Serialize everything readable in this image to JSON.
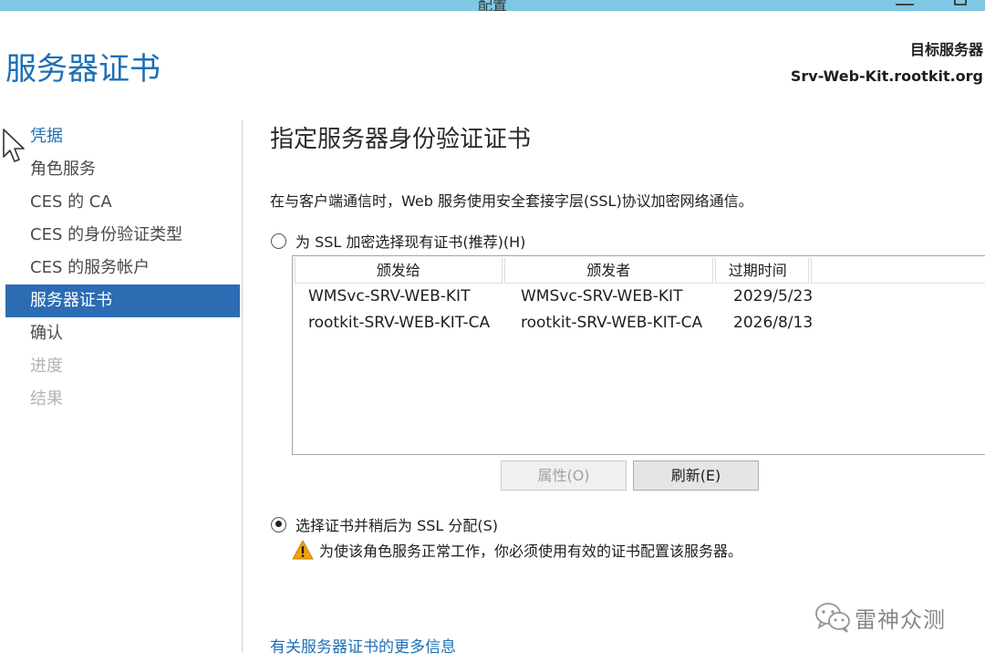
{
  "window": {
    "title": "配置"
  },
  "header": {
    "page_title": "服务器证书",
    "target_label": "目标服务器",
    "target_server": "Srv-Web-Kit.rootkit.org"
  },
  "nav": {
    "items": [
      {
        "label": "凭据",
        "state": "link"
      },
      {
        "label": "角色服务",
        "state": "normal"
      },
      {
        "label": "CES 的 CA",
        "state": "normal"
      },
      {
        "label": "CES 的身份验证类型",
        "state": "normal"
      },
      {
        "label": "CES 的服务帐户",
        "state": "normal"
      },
      {
        "label": "服务器证书",
        "state": "selected"
      },
      {
        "label": "确认",
        "state": "normal"
      },
      {
        "label": "进度",
        "state": "disabled"
      },
      {
        "label": "结果",
        "state": "disabled"
      }
    ]
  },
  "main": {
    "section_title": "指定服务器身份验证证书",
    "description": "在与客户端通信时，Web 服务使用安全套接字层(SSL)协议加密网络通信。",
    "option_existing": {
      "label": "为 SSL 加密选择现有证书(推荐)(H)",
      "checked": false
    },
    "cert_table": {
      "columns": [
        "颁发给",
        "颁发者",
        "过期时间"
      ],
      "rows": [
        {
          "issued_to": "WMSvc-SRV-WEB-KIT",
          "issued_by": "WMSvc-SRV-WEB-KIT",
          "expires": "2029/5/23"
        },
        {
          "issued_to": "rootkit-SRV-WEB-KIT-CA",
          "issued_by": "rootkit-SRV-WEB-KIT-CA",
          "expires": "2026/8/13"
        }
      ]
    },
    "buttons": {
      "properties": "属性(O)",
      "refresh": "刷新(E)"
    },
    "option_later": {
      "label": "选择证书并稍后为 SSL 分配(S)",
      "checked": true
    },
    "warning": "为使该角色服务正常工作，你必须使用有效的证书配置该服务器。",
    "more_info_link": "有关服务器证书的更多信息"
  },
  "watermark": {
    "text": "雷神众测"
  },
  "colors": {
    "accent": "#1d6fb5",
    "selected_bg": "#2b6cb3",
    "titlebar": "#80c7e5",
    "warning": "#f0a30a"
  },
  "icons": {
    "cursor": "mouse-pointer-icon",
    "warning": "warning-triangle-icon",
    "watermark": "wechat-icon"
  }
}
